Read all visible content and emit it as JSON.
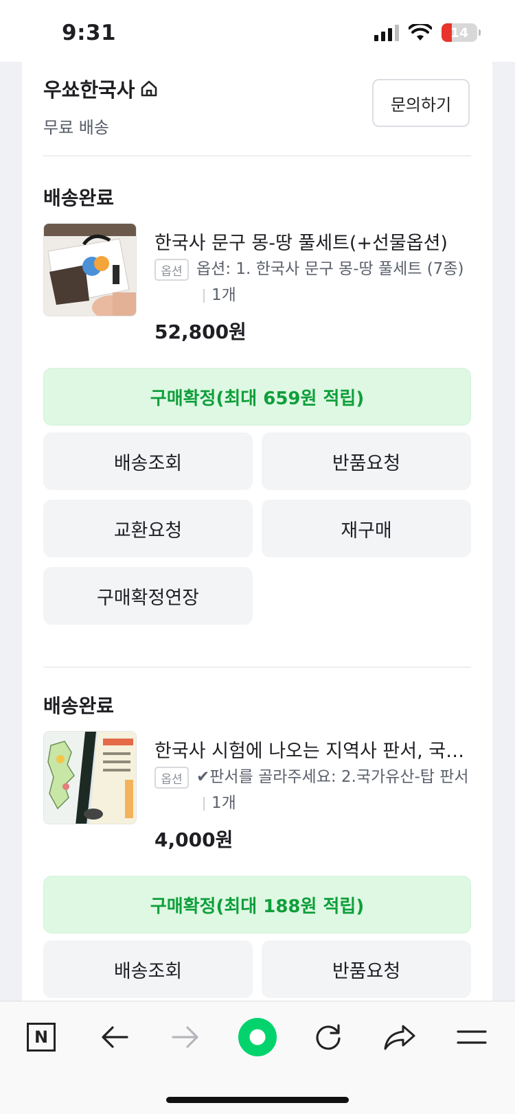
{
  "status": {
    "time": "9:31",
    "battery": "14",
    "battery_level": 0.14
  },
  "seller": {
    "name": "우쑈한국사",
    "shipping": "무료 배송",
    "inquiry_label": "문의하기"
  },
  "orders": [
    {
      "status": "배송완료",
      "title": "한국사 문구 몽-땅 풀세트(+선물옵션)",
      "option_badge": "옵션",
      "option_text": "옵션: 1. 한국사 문구 몽-땅 풀세트 (7종)",
      "quantity": "1개",
      "price": "52,800원",
      "confirm_label": "구매확정(최대 659원 적립)",
      "actions": [
        "배송조회",
        "반품요청",
        "교환요청",
        "재구매",
        "구매확정연장"
      ]
    },
    {
      "status": "배송완료",
      "title": "한국사 시험에 나오는 지역사 판서, 국…",
      "option_badge": "옵션",
      "option_text": "✔판서를 골라주세요: 2.국가유산-탑 판서",
      "quantity": "1개",
      "price": "4,000원",
      "confirm_label": "구매확정(최대 188원 적립)",
      "actions": [
        "배송조회",
        "반품요청"
      ]
    }
  ],
  "toolbar": {
    "items": [
      "naver-home-icon",
      "back-arrow-icon",
      "forward-arrow-icon",
      "green-dot-icon",
      "refresh-icon",
      "share-icon",
      "menu-icon"
    ]
  },
  "colors": {
    "accent_green": "#0e9f3b",
    "confirm_bg": "#dff8e3",
    "battery_red": "#e8342c"
  }
}
